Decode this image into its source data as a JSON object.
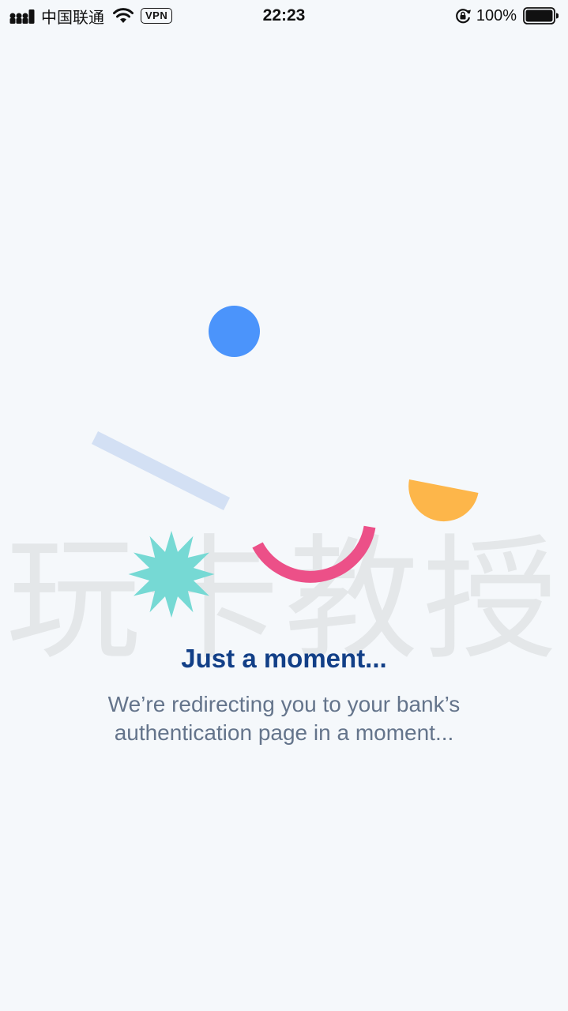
{
  "status_bar": {
    "carrier": "中国联通",
    "vpn_label": "VPN",
    "time": "22:23",
    "battery_percent": "100%",
    "icons": [
      "signal-icon",
      "wifi-icon",
      "orientation-lock-icon",
      "battery-icon"
    ]
  },
  "watermark": {
    "text": "玩卡教授"
  },
  "content": {
    "title": "Just a moment...",
    "subtitle": "We’re redirecting you to your bank’s authentication page in a moment..."
  },
  "colors": {
    "background": "#f5f8fb",
    "title": "#123f87",
    "subtitle": "#64748b",
    "circle": "#4b94fb",
    "line": "#d3e0f4",
    "star": "#76d9d4",
    "arc": "#ec5088",
    "semicircle": "#fdb64a"
  }
}
